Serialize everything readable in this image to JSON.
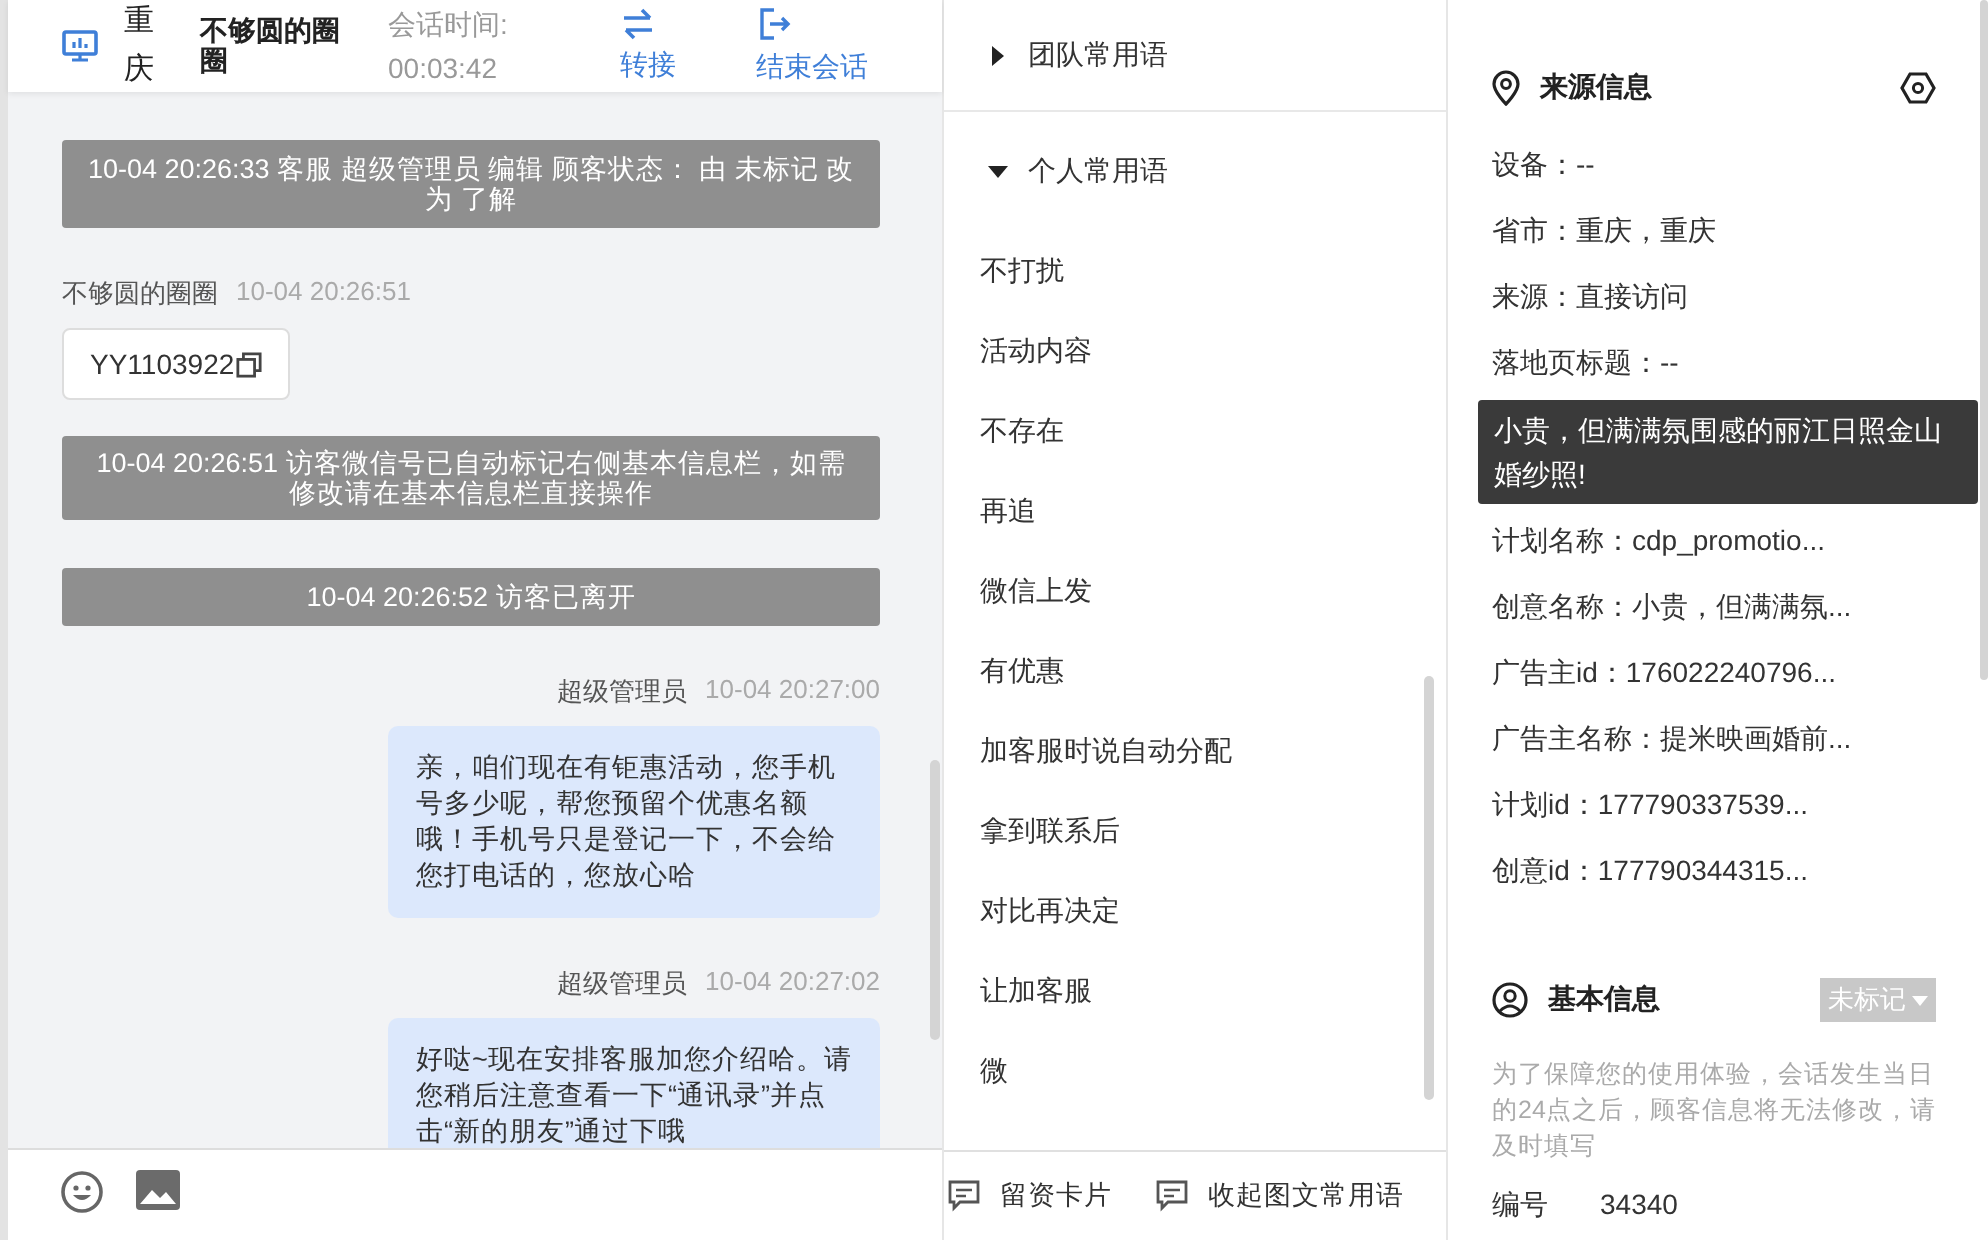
{
  "header": {
    "location": "重庆",
    "visitor": "不够圆的圈圈",
    "timer_label": "会话时间:",
    "timer": "00:03:42",
    "actions": [
      {
        "kind": "transfer",
        "label": "转接"
      },
      {
        "kind": "end",
        "label": "结束会话"
      }
    ]
  },
  "messages": [
    {
      "kind": "system",
      "text": "10-04 20:26:33 客服 超级管理员 编辑 顾客状态： 由 未标记 改为 了解"
    },
    {
      "kind": "visitor",
      "sender": "不够圆的圈圈",
      "time": "10-04 20:26:51",
      "text": "YY1103922"
    },
    {
      "kind": "system",
      "text": "10-04 20:26:51 访客微信号已自动标记右侧基本信息栏，如需修改请在基本信息栏直接操作"
    },
    {
      "kind": "system",
      "text": "10-04 20:26:52 访客已离开"
    },
    {
      "kind": "agent",
      "sender": "超级管理员",
      "time": "10-04 20:27:00",
      "text": "亲，咱们现在有钜惠活动，您手机号多少呢，帮您预留个优惠名额哦！手机号只是登记一下，不会给您打电话的，您放心哈"
    },
    {
      "kind": "agent",
      "sender": "超级管理员",
      "time": "10-04 20:27:02",
      "text": "好哒~现在安排客服加您介绍哈。请您稍后注意查看一下“通讯录”并点击“新的朋友”通过下哦"
    }
  ],
  "phrases": {
    "groups": [
      {
        "label": "团队常用语",
        "expanded": false
      },
      {
        "label": "个人常用语",
        "expanded": true,
        "items": [
          "不打扰",
          "活动内容",
          "不存在",
          "再追",
          "微信上发",
          "有优惠",
          "加客服时说自动分配",
          "拿到联系后",
          "对比再决定",
          "让加客服",
          "微"
        ]
      }
    ],
    "footer_buttons": [
      "留资卡片",
      "收起图文常用语"
    ]
  },
  "source_info": {
    "title": "来源信息",
    "rows_before": [
      "设备：--",
      "省市：重庆，重庆",
      "来源：直接访问",
      "落地页标题：--"
    ],
    "tooltip": "小贵，但满满氛围感的丽江日照金山婚纱照!",
    "rows_after": [
      "计划名称：cdp_promotio...",
      "创意名称：小贵，但满满氛...",
      "广告主id：176022240796...",
      "广告主名称：提米映画婚前...",
      "计划id：177790337539...",
      "创意id：177790344315..."
    ]
  },
  "basic_info": {
    "title": "基本信息",
    "tag": "未标记",
    "notice": "为了保障您的使用体验，会话发生当日的24点之后，顾客信息将无法修改，请及时填写",
    "fields": [
      {
        "label": "编号",
        "value": "34340"
      }
    ]
  }
}
